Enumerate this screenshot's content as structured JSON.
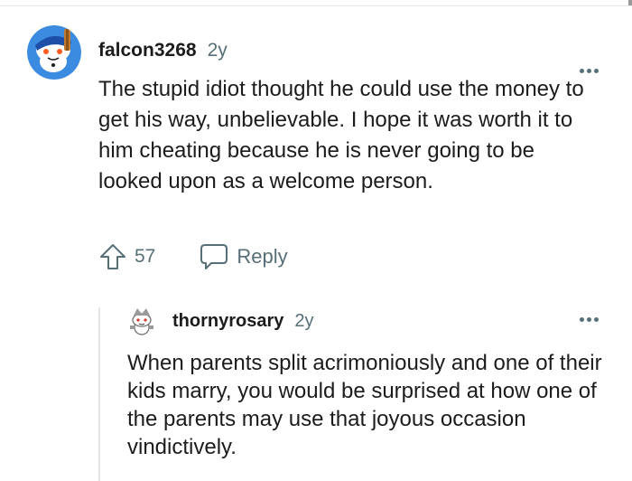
{
  "comment1": {
    "username": "falcon3268",
    "age": "2y",
    "text": "The stupid idiot thought he could use the money to get his way, unbelievable. I hope it was worth it to him cheating because he is never going to be looked upon as a welcome person.",
    "votes": "57",
    "reply_label": "Reply",
    "avatar_icon": "snoo-avatar-icon",
    "more_icon": "more-options-icon"
  },
  "comment2": {
    "username": "thornyrosary",
    "age": "2y",
    "text": "When parents split acrimoniously and one of their kids marry, you would be surprised at how one of the parents may use that joyous occasion vindictively.",
    "avatar_icon": "snoo-avatar-icon",
    "more_icon": "more-options-icon"
  },
  "colors": {
    "text": "#1c1c1c",
    "meta": "#576f76",
    "avatar_bg": "#3b8be0",
    "thread_line": "#e5e5e5"
  }
}
